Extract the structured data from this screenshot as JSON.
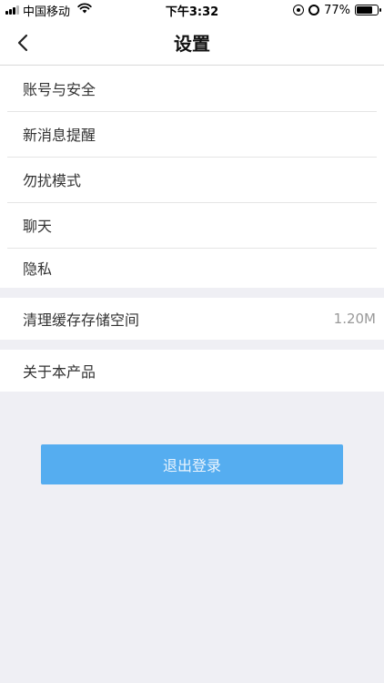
{
  "status_bar": {
    "carrier": "中国移动",
    "time": "下午3:32",
    "battery_percent": "77%",
    "battery_level": 0.77
  },
  "nav": {
    "title": "设置",
    "back_icon": "chevron-left-icon"
  },
  "groups": [
    {
      "items": [
        {
          "label": "账号与安全"
        },
        {
          "label": "新消息提醒"
        },
        {
          "label": "勿扰模式"
        },
        {
          "label": "聊天"
        },
        {
          "label": "隐私"
        }
      ]
    },
    {
      "items": [
        {
          "label": "清理缓存存储空间",
          "value": "1.20M"
        }
      ]
    },
    {
      "items": [
        {
          "label": "关于本产品"
        }
      ]
    }
  ],
  "logout": {
    "label": "退出登录",
    "color": "#55adf0"
  }
}
